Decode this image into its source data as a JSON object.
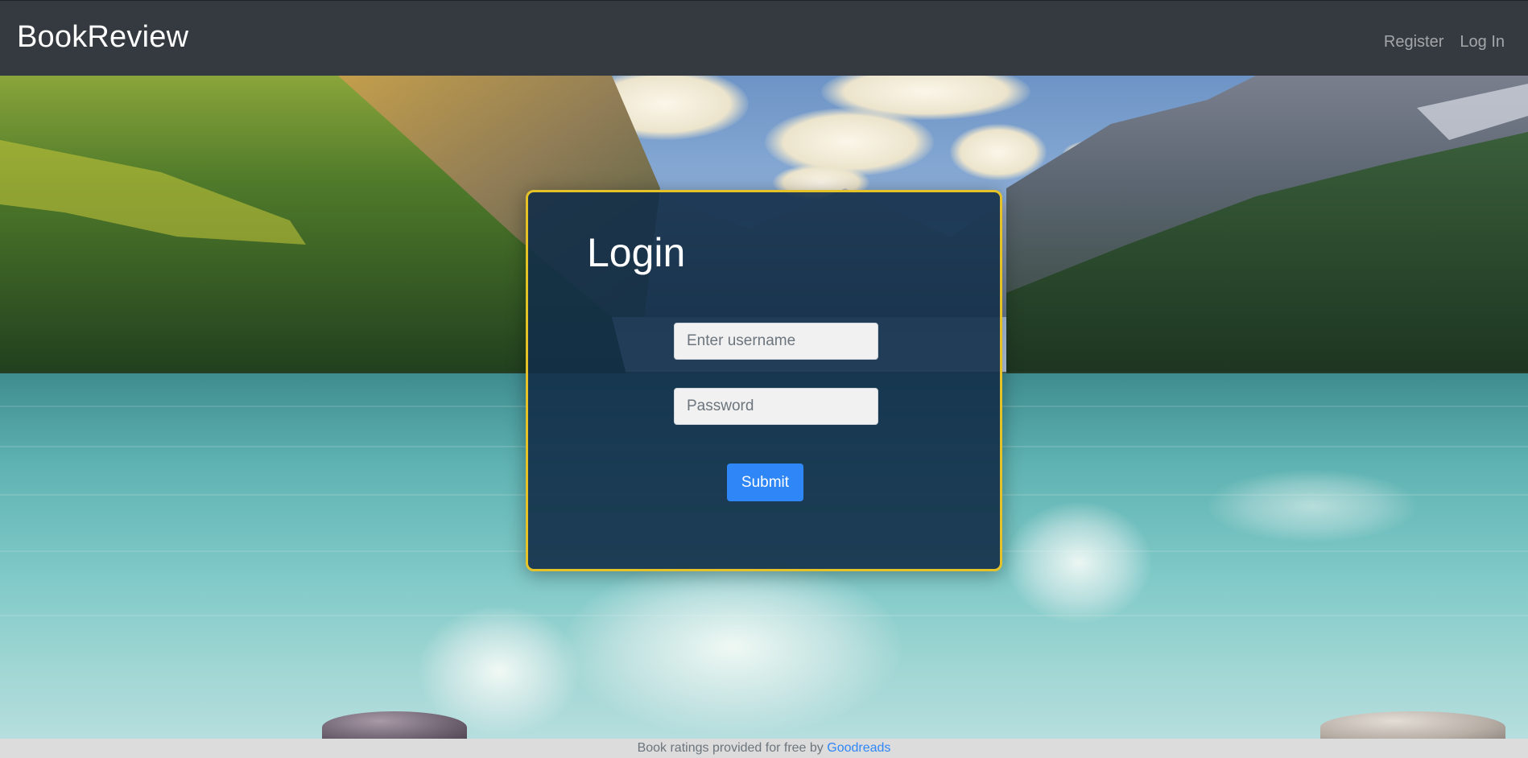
{
  "navbar": {
    "brand": "BookReview",
    "links": [
      "Register",
      "Log In"
    ]
  },
  "login": {
    "title": "Login",
    "username_placeholder": "Enter username",
    "password_placeholder": "Password",
    "submit_label": "Submit"
  },
  "footer": {
    "text": "Book ratings provided for free by ",
    "link_text": "Goodreads"
  },
  "colors": {
    "navbar_bg": "#343a40",
    "card_border": "#e6c229",
    "card_bg": "#122d48",
    "button_bg": "#2f86f6",
    "link": "#2f86f6"
  }
}
